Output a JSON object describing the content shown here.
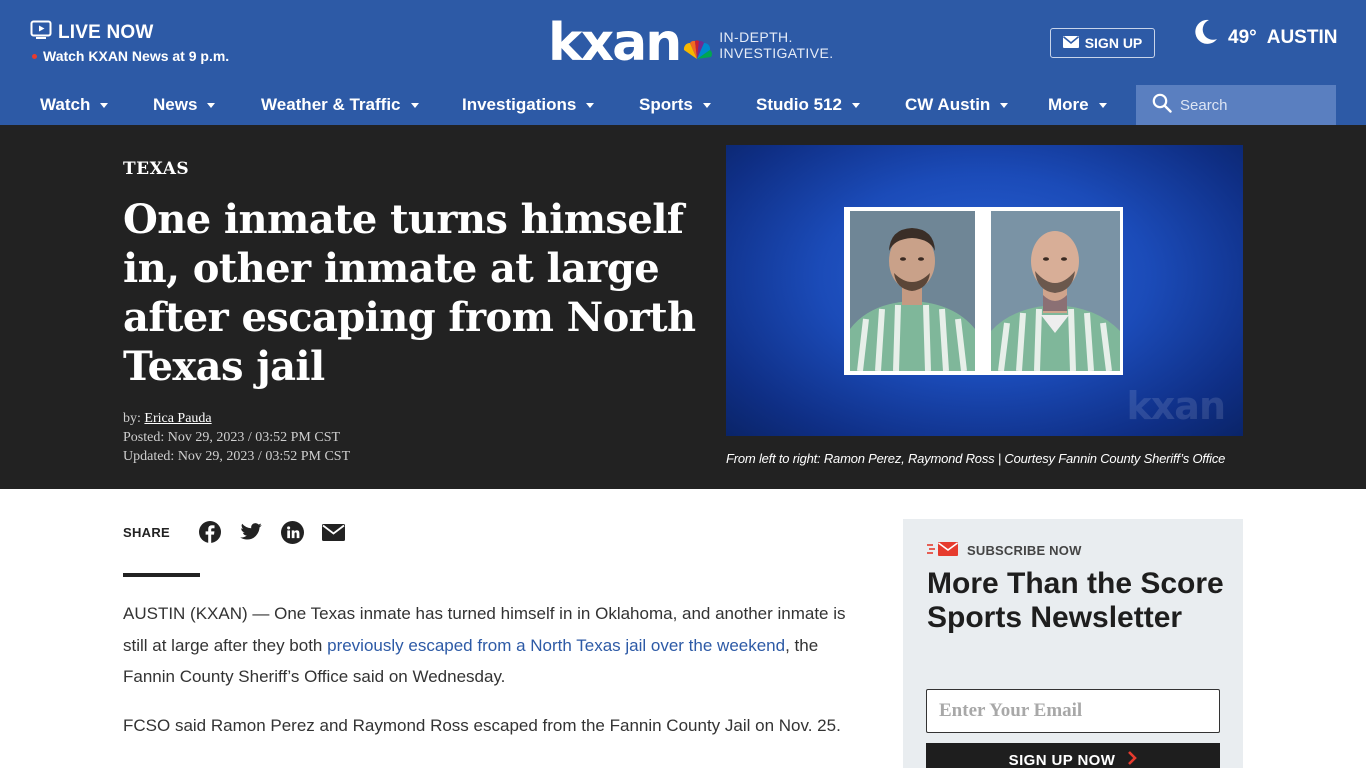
{
  "header": {
    "live_title": "LIVE NOW",
    "live_sub": "Watch KXAN News at 9 p.m.",
    "logo": "kxan",
    "tagline_1": "IN-DEPTH.",
    "tagline_2": "INVESTIGATIVE.",
    "signup_label": "SIGN UP",
    "weather_temp": "49°",
    "weather_city": "AUSTIN",
    "weather_icon": "moon-icon"
  },
  "nav": {
    "items": [
      {
        "label": "Watch"
      },
      {
        "label": "News"
      },
      {
        "label": "Weather & Traffic"
      },
      {
        "label": "Investigations"
      },
      {
        "label": "Sports"
      },
      {
        "label": "Studio 512"
      },
      {
        "label": "CW Austin"
      },
      {
        "label": "More"
      }
    ],
    "search_placeholder": "Search"
  },
  "article": {
    "kicker": "TEXAS",
    "headline": "One inmate turns himself in, other inmate at large after escaping from North Texas jail",
    "by_label": "by:",
    "author": "Erica Pauda",
    "posted": "Posted: Nov 29, 2023 / 03:52 PM CST",
    "updated": "Updated: Nov 29, 2023 / 03:52 PM CST",
    "caption": "From left to right: Ramon Perez, Raymond Ross | Courtesy Fannin County Sheriff’s Office",
    "image_watermark": "kxan",
    "share_label": "SHARE",
    "p1_before": "AUSTIN (KXAN) — One Texas inmate has turned himself in in Oklahoma, and another inmate is still at large after they both ",
    "p1_link": "previously escaped from a North Texas jail over the weekend",
    "p1_after": ", the Fannin County Sheriff’s Office said on Wednesday.",
    "p2": "FCSO said Ramon Perez and Raymond Ross escaped from the Fannin County Jail on Nov. 25."
  },
  "newsletter": {
    "kicker": "SUBSCRIBE NOW",
    "title": "More Than the Score Sports Newsletter",
    "email_placeholder": "Enter Your Email",
    "button_label": "SIGN UP NOW"
  },
  "colors": {
    "brand_blue": "#2d5aa6",
    "hero_bg": "#222222",
    "link": "#2d5aa6",
    "accent_red": "#e63b2e"
  }
}
